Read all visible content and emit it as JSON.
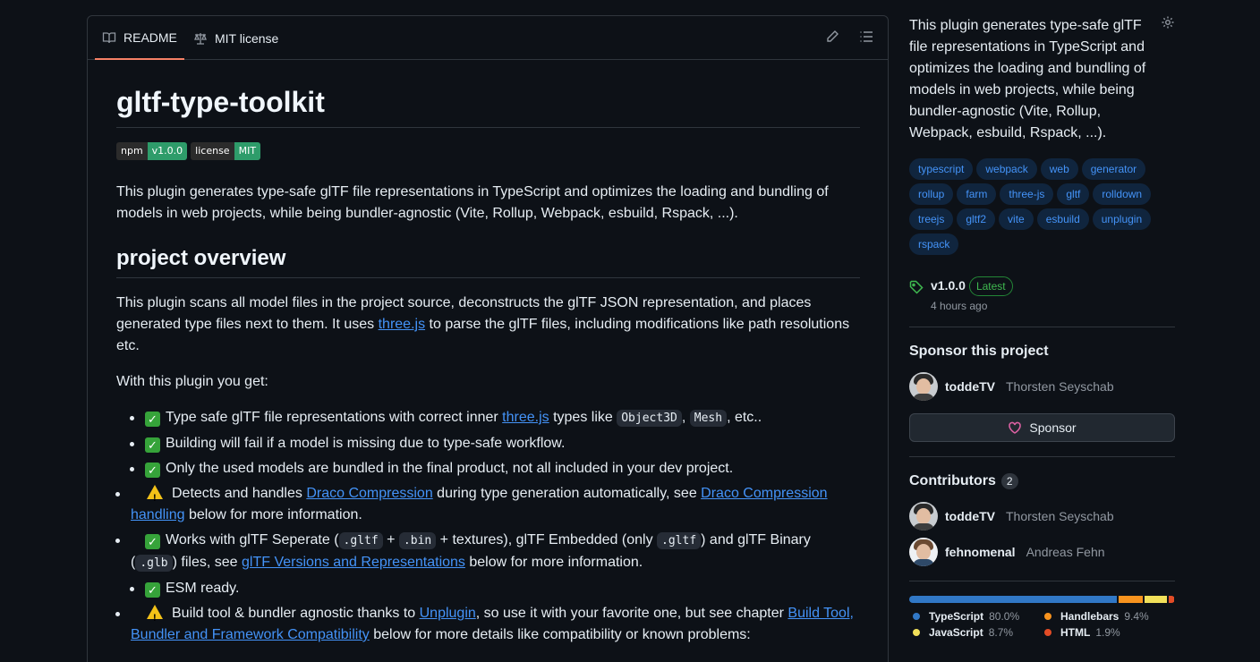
{
  "readme_tabs": {
    "readme": "README",
    "license": "MIT license"
  },
  "readme": {
    "title": "gltf-type-toolkit",
    "badges": [
      {
        "key": "npm",
        "value": "v1.0.0"
      },
      {
        "key": "license",
        "value": "MIT"
      }
    ],
    "description": "This plugin generates type-safe glTF file representations in TypeScript and optimizes the loading and bundling of models in web projects, while being bundler-agnostic (Vite, Rollup, Webpack, esbuild, Rspack, ...).",
    "overview_heading": "project overview",
    "overview_pre": "This plugin scans all model files in the project source, deconstructs the glTF JSON representation, and places generated type files next to them. It uses ",
    "overview_link": "three.js",
    "overview_post": " to parse the glTF files, including modifications like path resolutions etc.",
    "get_intro": "With this plugin you get:",
    "features": {
      "f1_pre": "Type safe glTF file representations with correct inner ",
      "f1_link": "three.js",
      "f1_mid": " types like ",
      "f1_code1": "Object3D",
      "f1_comma": ", ",
      "f1_code2": "Mesh",
      "f1_post": ", etc..",
      "f2": "Building will fail if a model is missing due to type-safe workflow.",
      "f3": "Only the used models are bundled in the final product, not all included in your dev project.",
      "f4_pre": "Detects and handles ",
      "f4_link1": "Draco Compression",
      "f4_mid": " during type generation automatically, see ",
      "f4_link2": "Draco Compression handling",
      "f4_post": " below for more information.",
      "f5_pre": "Works with glTF Seperate (",
      "f5_code1": ".gltf",
      "f5_plus1": " + ",
      "f5_code2": ".bin",
      "f5_mid1": " + textures), glTF Embedded (only ",
      "f5_code3": ".gltf",
      "f5_mid2": ") and glTF Binary (",
      "f5_code4": ".glb",
      "f5_mid3": ") files, see ",
      "f5_link": "glTF Versions and Representations",
      "f5_post": " below for more information.",
      "f6": "ESM ready.",
      "f7_pre": "Build tool & bundler agnostic thanks to ",
      "f7_link1": "Unplugin",
      "f7_mid": ", so use it with your favorite one, but see chapter ",
      "f7_link2": "Build Tool, Bundler and Framework Compatibility",
      "f7_post": " below for more details like compatibility or known problems:"
    }
  },
  "sidebar": {
    "about": "This plugin generates type-safe glTF file representations in TypeScript and optimizes the loading and bundling of models in web projects, while being bundler-agnostic (Vite, Rollup, Webpack, esbuild, Rspack, ...).",
    "topics": [
      "typescript",
      "webpack",
      "web",
      "generator",
      "rollup",
      "farm",
      "three-js",
      "gltf",
      "rolldown",
      "treejs",
      "gltf2",
      "vite",
      "esbuild",
      "unplugin",
      "rspack"
    ],
    "release": {
      "version": "v1.0.0",
      "badge": "Latest",
      "time": "4 hours ago"
    },
    "sponsor": {
      "heading": "Sponsor this project",
      "login": "toddeTV",
      "name": "Thorsten Seyschab",
      "button": "Sponsor"
    },
    "contributors": {
      "heading": "Contributors",
      "count": "2",
      "people": [
        {
          "login": "toddeTV",
          "name": "Thorsten Seyschab"
        },
        {
          "login": "fehnomenal",
          "name": "Andreas Fehn"
        }
      ]
    },
    "languages": [
      {
        "name": "TypeScript",
        "percent": "80.0%",
        "value": 80.0,
        "color": "#3178c6"
      },
      {
        "name": "Handlebars",
        "percent": "9.4%",
        "value": 9.4,
        "color": "#f7931e"
      },
      {
        "name": "JavaScript",
        "percent": "8.7%",
        "value": 8.7,
        "color": "#f1e05a"
      },
      {
        "name": "HTML",
        "percent": "1.9%",
        "value": 1.9,
        "color": "#e34c26"
      }
    ]
  }
}
